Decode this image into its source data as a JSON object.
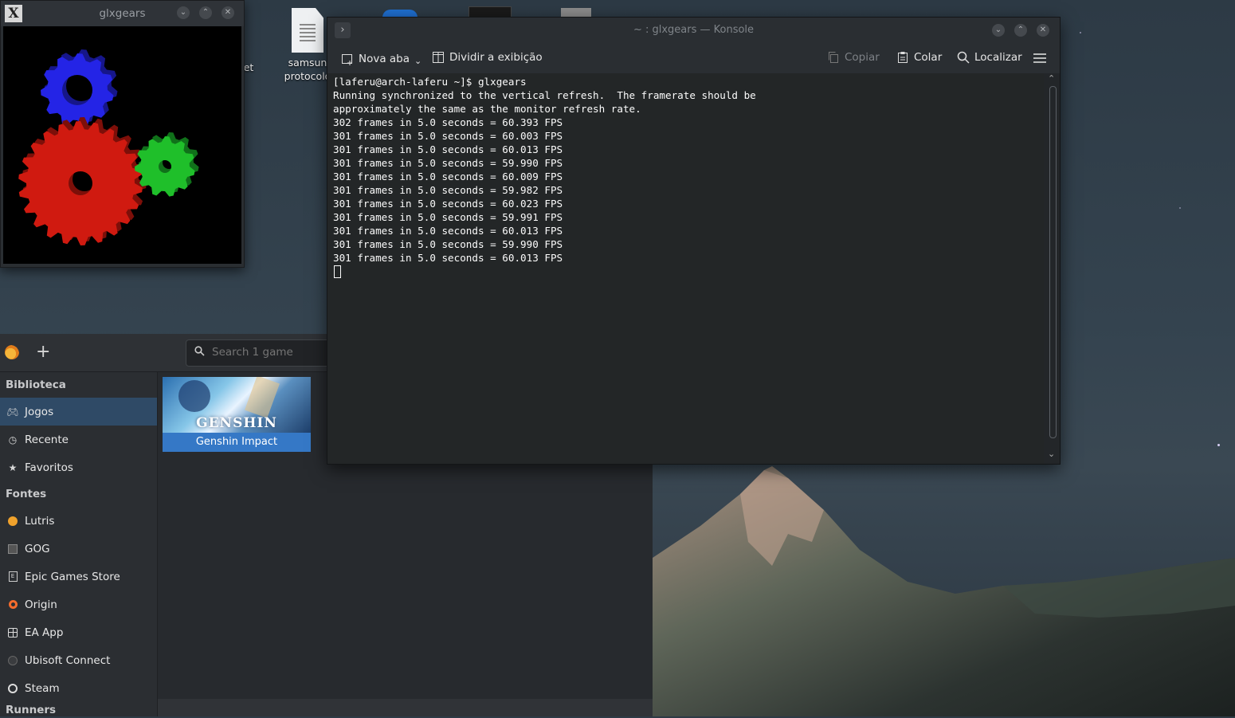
{
  "desktop": {
    "icons": [
      {
        "label_line1": "samsun",
        "label_line2": "protocolo"
      },
      {
        "label_line1": "et",
        "label_line2": ""
      }
    ]
  },
  "glxgears": {
    "title": "glxgears",
    "app_icon_glyph": "X"
  },
  "konsole": {
    "title": "~ : glxgears — Konsole",
    "toolbar": {
      "new_tab": "Nova aba",
      "split_view": "Dividir a exibição",
      "copy": "Copiar",
      "paste": "Colar",
      "find": "Localizar"
    },
    "lines": [
      "[laferu@arch-laferu ~]$ glxgears",
      "Running synchronized to the vertical refresh.  The framerate should be",
      "approximately the same as the monitor refresh rate.",
      "302 frames in 5.0 seconds = 60.393 FPS",
      "301 frames in 5.0 seconds = 60.003 FPS",
      "301 frames in 5.0 seconds = 60.013 FPS",
      "301 frames in 5.0 seconds = 59.990 FPS",
      "301 frames in 5.0 seconds = 60.009 FPS",
      "301 frames in 5.0 seconds = 59.982 FPS",
      "301 frames in 5.0 seconds = 60.023 FPS",
      "301 frames in 5.0 seconds = 59.991 FPS",
      "301 frames in 5.0 seconds = 60.013 FPS",
      "301 frames in 5.0 seconds = 59.990 FPS",
      "301 frames in 5.0 seconds = 60.013 FPS"
    ]
  },
  "lutris": {
    "search_placeholder": "Search 1 game",
    "sections": {
      "library": "Biblioteca",
      "sources": "Fontes",
      "runners": "Runners"
    },
    "library_items": [
      {
        "label": "Jogos",
        "icon": "gamepad-icon",
        "active": true
      },
      {
        "label": "Recente",
        "icon": "clock-icon"
      },
      {
        "label": "Favoritos",
        "icon": "star-icon"
      }
    ],
    "source_items": [
      {
        "label": "Lutris",
        "icon": "lutris-icon"
      },
      {
        "label": "GOG",
        "icon": "gog-icon"
      },
      {
        "label": "Epic Games Store",
        "icon": "epic-icon"
      },
      {
        "label": "Origin",
        "icon": "origin-icon"
      },
      {
        "label": "EA App",
        "icon": "ea-icon"
      },
      {
        "label": "Ubisoft Connect",
        "icon": "ubisoft-icon"
      },
      {
        "label": "Steam",
        "icon": "steam-icon"
      }
    ],
    "games": [
      {
        "title": "Genshin Impact",
        "cover_text": "GENSHIN"
      }
    ]
  },
  "colors": {
    "konsole_bg": "#232627",
    "sidebar_active": "#2f4a66",
    "game_tile": "#3578c6",
    "gear_red": "#d01a10",
    "gear_green": "#1fbf2a",
    "gear_blue": "#2424e6"
  }
}
